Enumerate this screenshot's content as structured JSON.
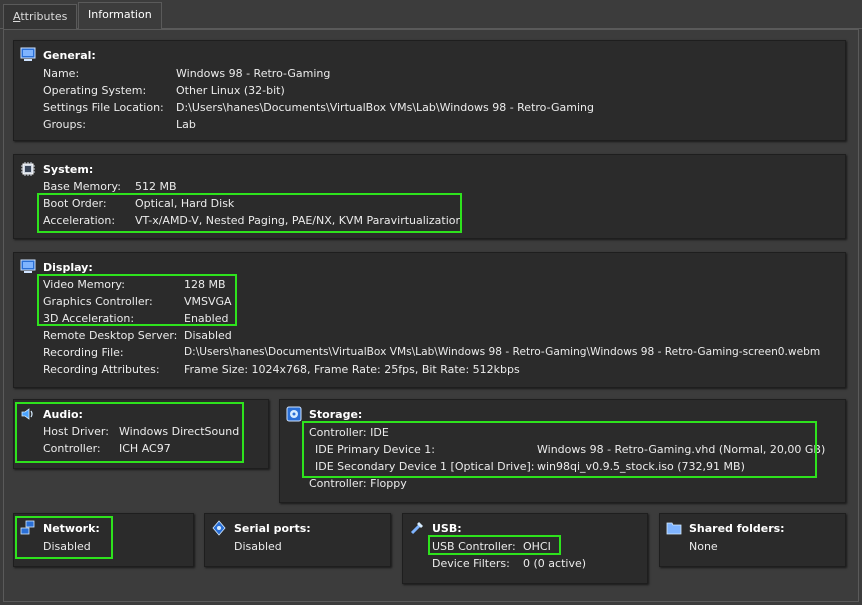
{
  "tabs": [
    {
      "label_u": "A",
      "label_rest": "ttributes"
    },
    {
      "label": "Information"
    }
  ],
  "general": {
    "title": "General:",
    "rows": [
      {
        "label": "Name:",
        "value": "Windows 98 - Retro-Gaming"
      },
      {
        "label": "Operating System:",
        "value": "Other Linux (32-bit)"
      },
      {
        "label": "Settings File Location:",
        "value": "D:\\Users\\hanes\\Documents\\VirtualBox VMs\\Lab\\Windows 98 - Retro-Gaming"
      },
      {
        "label": "Groups:",
        "value": "Lab"
      }
    ]
  },
  "system": {
    "title": "System:",
    "rows": [
      {
        "label": "Base Memory:",
        "value": "512 MB"
      },
      {
        "label": "Boot Order:",
        "value": "Optical, Hard Disk"
      },
      {
        "label": "Acceleration:",
        "value": "VT-x/AMD-V, Nested Paging, PAE/NX, KVM Paravirtualization"
      }
    ]
  },
  "display": {
    "title": "Display:",
    "rows": [
      {
        "label": "Video Memory:",
        "value": "128 MB"
      },
      {
        "label": "Graphics Controller:",
        "value": "VMSVGA"
      },
      {
        "label": "3D Acceleration:",
        "value": "Enabled"
      },
      {
        "label": "Remote Desktop Server:",
        "value": "Disabled"
      },
      {
        "label": "Recording File:",
        "value": "D:\\Users\\hanes\\Documents\\VirtualBox VMs\\Lab\\Windows 98 - Retro-Gaming\\Windows 98 - Retro-Gaming-screen0.webm"
      },
      {
        "label": "Recording Attributes:",
        "value": "Frame Size: 1024x768, Frame Rate: 25fps, Bit Rate: 512kbps"
      }
    ]
  },
  "audio": {
    "title": "Audio:",
    "rows": [
      {
        "label": "Host Driver:",
        "value": "Windows DirectSound"
      },
      {
        "label": "Controller:",
        "value": "ICH AC97"
      }
    ]
  },
  "storage": {
    "title": "Storage:",
    "controller_ide": "Controller: IDE",
    "rows": [
      {
        "label": "IDE Primary Device 1:",
        "value": "Windows 98 - Retro-Gaming.vhd (Normal, 20,00 GB)"
      },
      {
        "label": "IDE Secondary Device 1 [Optical Drive]:",
        "value": "win98qi_v0.9.5_stock.iso (732,91 MB)"
      }
    ],
    "controller_floppy": "Controller: Floppy"
  },
  "network": {
    "title": "Network:",
    "value": "Disabled"
  },
  "serial": {
    "title": "Serial ports:",
    "value": "Disabled"
  },
  "usb": {
    "title": "USB:",
    "rows": [
      {
        "label": "USB Controller:",
        "value": "OHCI"
      },
      {
        "label": "Device Filters:",
        "value": "0 (0 active)"
      }
    ]
  },
  "shared": {
    "title": "Shared folders:",
    "value": "None"
  },
  "highlight_color": "#2ee21d"
}
